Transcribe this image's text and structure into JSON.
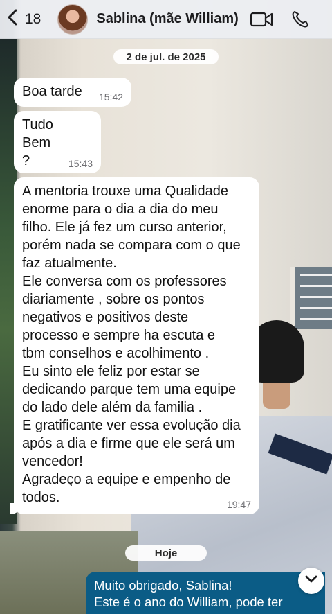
{
  "header": {
    "back_count": "18",
    "contact_name": "Sablina (mãe William)",
    "icons": [
      "chevron-left-icon",
      "video-camera-icon",
      "phone-icon"
    ]
  },
  "chat": {
    "date_divider": "2 de jul. de 2025",
    "today_divider": "Hoje",
    "messages": [
      {
        "direction": "incoming",
        "text": "Boa tarde",
        "time": "15:42"
      },
      {
        "direction": "incoming",
        "text": "Tudo\nBem\n?",
        "time": "15:43"
      },
      {
        "direction": "incoming",
        "text": "A mentoria trouxe uma Qualidade\nenorme para o dia a dia do meu\nfilho. Ele já fez um curso anterior,\nporém nada se compara com o que\nfaz atualmente.\nEle conversa com os professores\ndiariamente , sobre os pontos\nnegativos e positivos deste\nprocesso e sempre ha escuta e\ntbm conselhos e acolhimento .\nEu sinto ele feliz por estar se\ndedicando parque tem uma equipe\ndo lado dele além da familia .\nE gratificante ver essa evolução dia\napós a dia e firme que ele será um\nvencedor!\nAgradeço a equipe e empenho de\ntodos.",
        "time": "19:47"
      },
      {
        "direction": "outgoing",
        "text": "Muito obrigado, Sablina!\nEste é o ano do William, pode ter"
      }
    ]
  },
  "colors": {
    "outgoing_bubble": "#0b5c86",
    "incoming_bubble": "#ffffff",
    "header_bg": "#eceef2"
  }
}
